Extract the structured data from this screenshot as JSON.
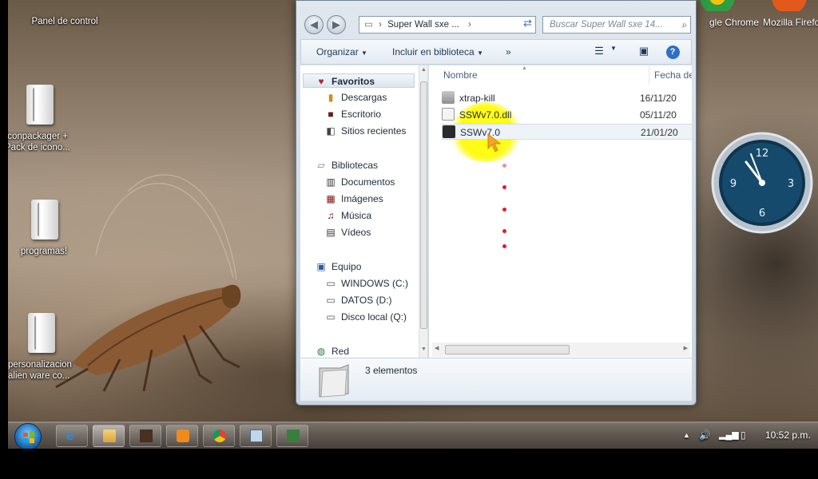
{
  "desktop": {
    "icons": [
      {
        "label": "Panel de control"
      },
      {
        "label": "Iconpackager + Pack de icono..."
      },
      {
        "label": "programas!"
      },
      {
        "label": "personalizacion alien ware co..."
      }
    ],
    "top_apps": [
      {
        "label": "gle Chrome"
      },
      {
        "label": "Mozilla Firefo"
      }
    ]
  },
  "clock": {
    "n12": "12",
    "n3": "3",
    "n6": "6",
    "n9": "9"
  },
  "explorer": {
    "address": "Super Wall sxe ...",
    "address_sep1": "›",
    "address_sep2": "›",
    "search_placeholder": "Buscar Super Wall sxe 14...",
    "toolbar": {
      "organize": "Organizar",
      "include_library": "Incluir en biblioteca",
      "more": "»"
    },
    "nav": {
      "favorites": "Favoritos",
      "downloads": "Descargas",
      "desktop": "Escritorio",
      "recent": "Sitios recientes",
      "libraries": "Bibliotecas",
      "documents": "Documentos",
      "images": "Imágenes",
      "music": "Música",
      "videos": "Vídeos",
      "computer": "Equipo",
      "drive_c": "WINDOWS (C:)",
      "drive_d": "DATOS (D:)",
      "drive_q": "Disco local (Q:)",
      "network": "Red"
    },
    "columns": {
      "name": "Nombre",
      "date": "Fecha de"
    },
    "files": [
      {
        "name": "xtrap-kill",
        "date": "16/11/20"
      },
      {
        "name": "SSWv7.0.dll",
        "date": "05/11/20"
      },
      {
        "name": "SSWv7.0",
        "date": "21/01/20"
      }
    ],
    "status": "3 elementos"
  },
  "taskbar": {
    "time": "10:52 p.m."
  },
  "colors": {
    "highlight": "#ffff00",
    "accent": "#1d6fb8"
  }
}
